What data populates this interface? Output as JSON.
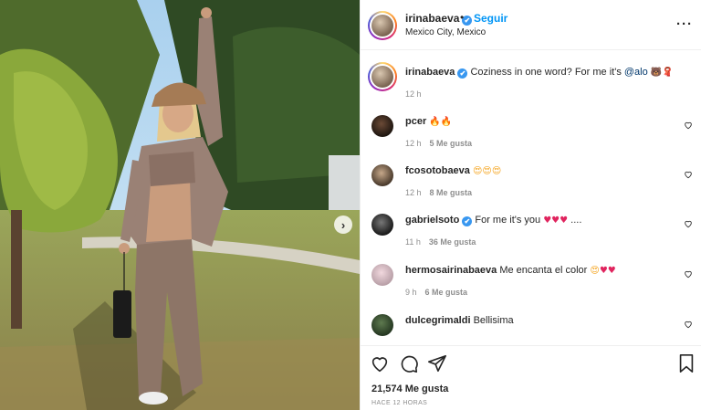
{
  "post": {
    "header": {
      "username": "irinabaeva",
      "verified_mark": "✔",
      "separator": "•",
      "follow_label": "Seguir",
      "location": "Mexico City, Mexico",
      "more_label": "···"
    },
    "caption": {
      "username": "irinabaeva",
      "verified_mark": "✔",
      "text_before": "Coziness in one word? For me it's ",
      "mention": "@alo",
      "emojis": "🐻🧣",
      "time": "12 h"
    },
    "comments": [
      {
        "username": "pcer",
        "verified": false,
        "text": "",
        "emojis": "🔥🔥",
        "time": "12 h",
        "likes": "5 Me gusta"
      },
      {
        "username": "fcosotobaeva",
        "verified": false,
        "text": "",
        "emojis": "😍😍😍",
        "time": "12 h",
        "likes": "8 Me gusta"
      },
      {
        "username": "gabrielsoto",
        "verified": true,
        "verified_mark": "✔",
        "text": "For me it's you ",
        "emojis": "♥♥♥",
        "text_after": " ....",
        "time": "11 h",
        "likes": "36 Me gusta"
      },
      {
        "username": "hermosairinabaeva",
        "verified": false,
        "text": "Me encanta el color ",
        "emojis_a": "😍",
        "emojis": "♥♥",
        "time": "9 h",
        "likes": "6 Me gusta"
      },
      {
        "username": "dulcegrimaldi",
        "verified": false,
        "text": "Bellisima",
        "emojis": "",
        "time": "",
        "likes": ""
      }
    ],
    "actions": {
      "like_icon": "heart-icon",
      "comment_icon": "comment-icon",
      "share_icon": "share-icon",
      "save_icon": "bookmark-icon"
    },
    "likes_count": "21,574 Me gusta",
    "time_ago": "HACE 12 HORAS",
    "carousel_next": "›",
    "colors": {
      "follow_blue": "#0095f6",
      "verified_blue": "#3897f0",
      "mention": "#00376b",
      "meta_gray": "#8e8e8e",
      "text": "#262626"
    }
  }
}
